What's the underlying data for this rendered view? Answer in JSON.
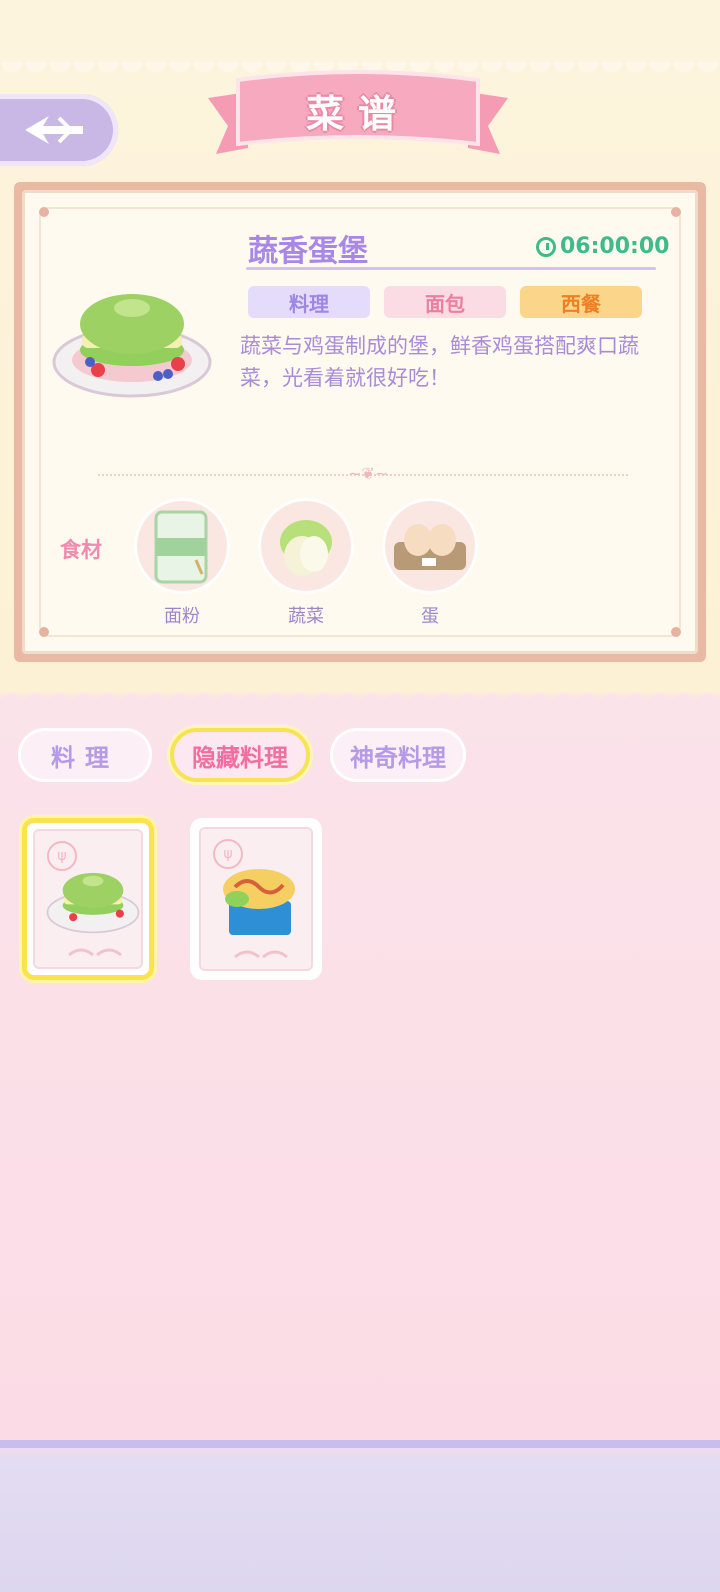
{
  "header": {
    "title": "菜谱",
    "back_icon": "back-arrow-icon"
  },
  "recipe": {
    "name": "蔬香蛋堡",
    "timer": "06:00:00",
    "tags": [
      "料理",
      "面包",
      "西餐"
    ],
    "description": "蔬菜与鸡蛋制成的堡，鲜香鸡蛋搭配爽口蔬菜，光看着就很好吃！",
    "ingredients_label": "食材",
    "ingredients": [
      {
        "name": "面粉",
        "icon": "flour-bag-icon"
      },
      {
        "name": "蔬菜",
        "icon": "cabbage-icon"
      },
      {
        "name": "蛋",
        "icon": "egg-carton-icon"
      }
    ]
  },
  "tabs": [
    {
      "label": "料理",
      "selected": false
    },
    {
      "label": "隐藏料理",
      "selected": true
    },
    {
      "label": "神奇料理",
      "selected": false
    }
  ],
  "recipe_cards": [
    {
      "dish": "vegetable-egg-burger-icon",
      "selected": true
    },
    {
      "dish": "omelette-sandwich-icon",
      "selected": false
    }
  ],
  "colors": {
    "accent_purple": "#a987e6",
    "timer_green": "#3dbb8a",
    "highlight_yellow": "#fbe24e",
    "pink": "#f28ab0"
  }
}
